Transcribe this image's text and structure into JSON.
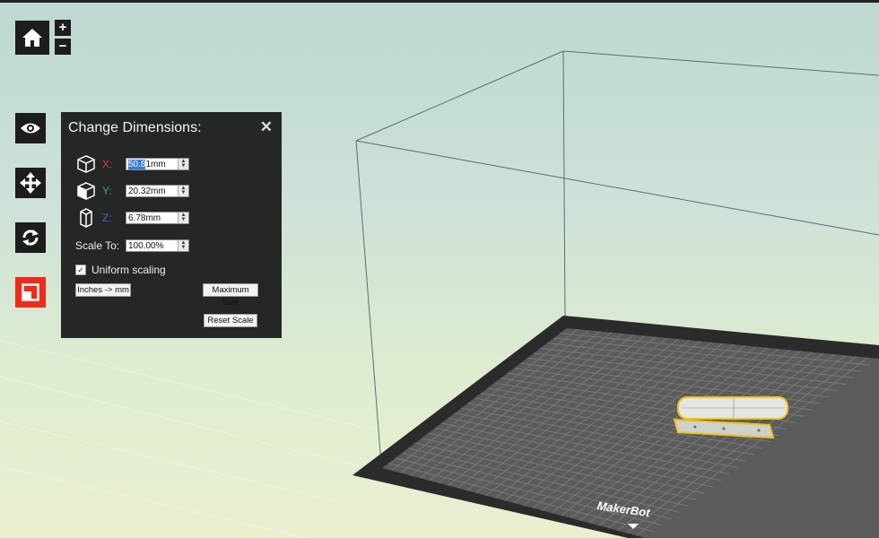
{
  "toolbar": {
    "home_icon": "home-icon",
    "zoom_in_label": "+",
    "zoom_out_label": "−",
    "tools": [
      "view-icon",
      "move-icon",
      "rotate-icon",
      "scale-icon"
    ]
  },
  "panel": {
    "title": "Change Dimensions:",
    "close_label": "✕",
    "x": {
      "axis_label": "X:",
      "value_selected": "50.8",
      "value_rest": "1mm",
      "color": "#d9413a"
    },
    "y": {
      "axis_label": "Y:",
      "value": "20.32mm",
      "color": "#3fae4a"
    },
    "z": {
      "axis_label": "Z:",
      "value": "6.78mm",
      "color": "#3a6fd8"
    },
    "scale_label": "Scale To:",
    "scale_value": "100.00%",
    "uniform_label": "Uniform scaling",
    "uniform_checked": true,
    "inches_button": "Inches -> mm",
    "max_size_button": "Maximum Size",
    "reset_scale_button": "Reset Scale"
  },
  "build_plate": {
    "brand_label": "MakerBot"
  },
  "colors": {
    "active_tool": "#ee2a1d",
    "selection_outline": "#f0c419"
  }
}
